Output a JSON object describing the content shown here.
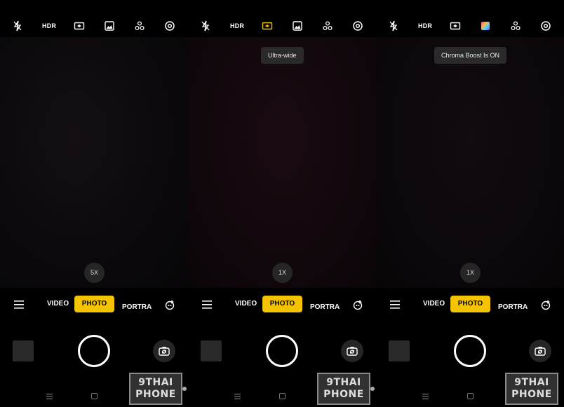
{
  "panels": [
    {
      "top_icons": [
        "flash-off-icon",
        "hdr-text",
        "ultrawide-icon",
        "image-filter-icon",
        "ai-scene-icon",
        "settings-icon"
      ],
      "hdr_label": "HDR",
      "ultrawide_active": false,
      "toast": "",
      "zoom_label": "5X",
      "modes": {
        "video": "VIDEO",
        "photo": "PHOTO",
        "portrait": "PORTRAIT"
      },
      "watermark": "9THAI\nPHONE"
    },
    {
      "top_icons": [
        "flash-off-icon",
        "hdr-text",
        "ultrawide-icon",
        "image-filter-icon",
        "ai-scene-icon",
        "settings-icon"
      ],
      "hdr_label": "HDR",
      "ultrawide_active": true,
      "toast": "Ultra-wide",
      "zoom_label": "1X",
      "modes": {
        "video": "VIDEO",
        "photo": "PHOTO",
        "portrait": "PORTRAIT"
      },
      "watermark": "9THAI\nPHONE"
    },
    {
      "top_icons": [
        "flash-off-icon",
        "hdr-text",
        "ultrawide-icon",
        "chroma-boost-icon",
        "ai-scene-icon",
        "settings-icon"
      ],
      "hdr_label": "HDR",
      "ultrawide_active": false,
      "toast": "Chroma Boost Is ON",
      "zoom_label": "1X",
      "modes": {
        "video": "VIDEO",
        "photo": "PHOTO",
        "portrait": "PORTRAIT"
      },
      "watermark": "9THAI\nPHONE"
    }
  ],
  "colors": {
    "accent": "#f5c400",
    "active_icon": "#f5c400",
    "toast_bg": "#2a2a2a",
    "pill_bg": "#262626"
  }
}
